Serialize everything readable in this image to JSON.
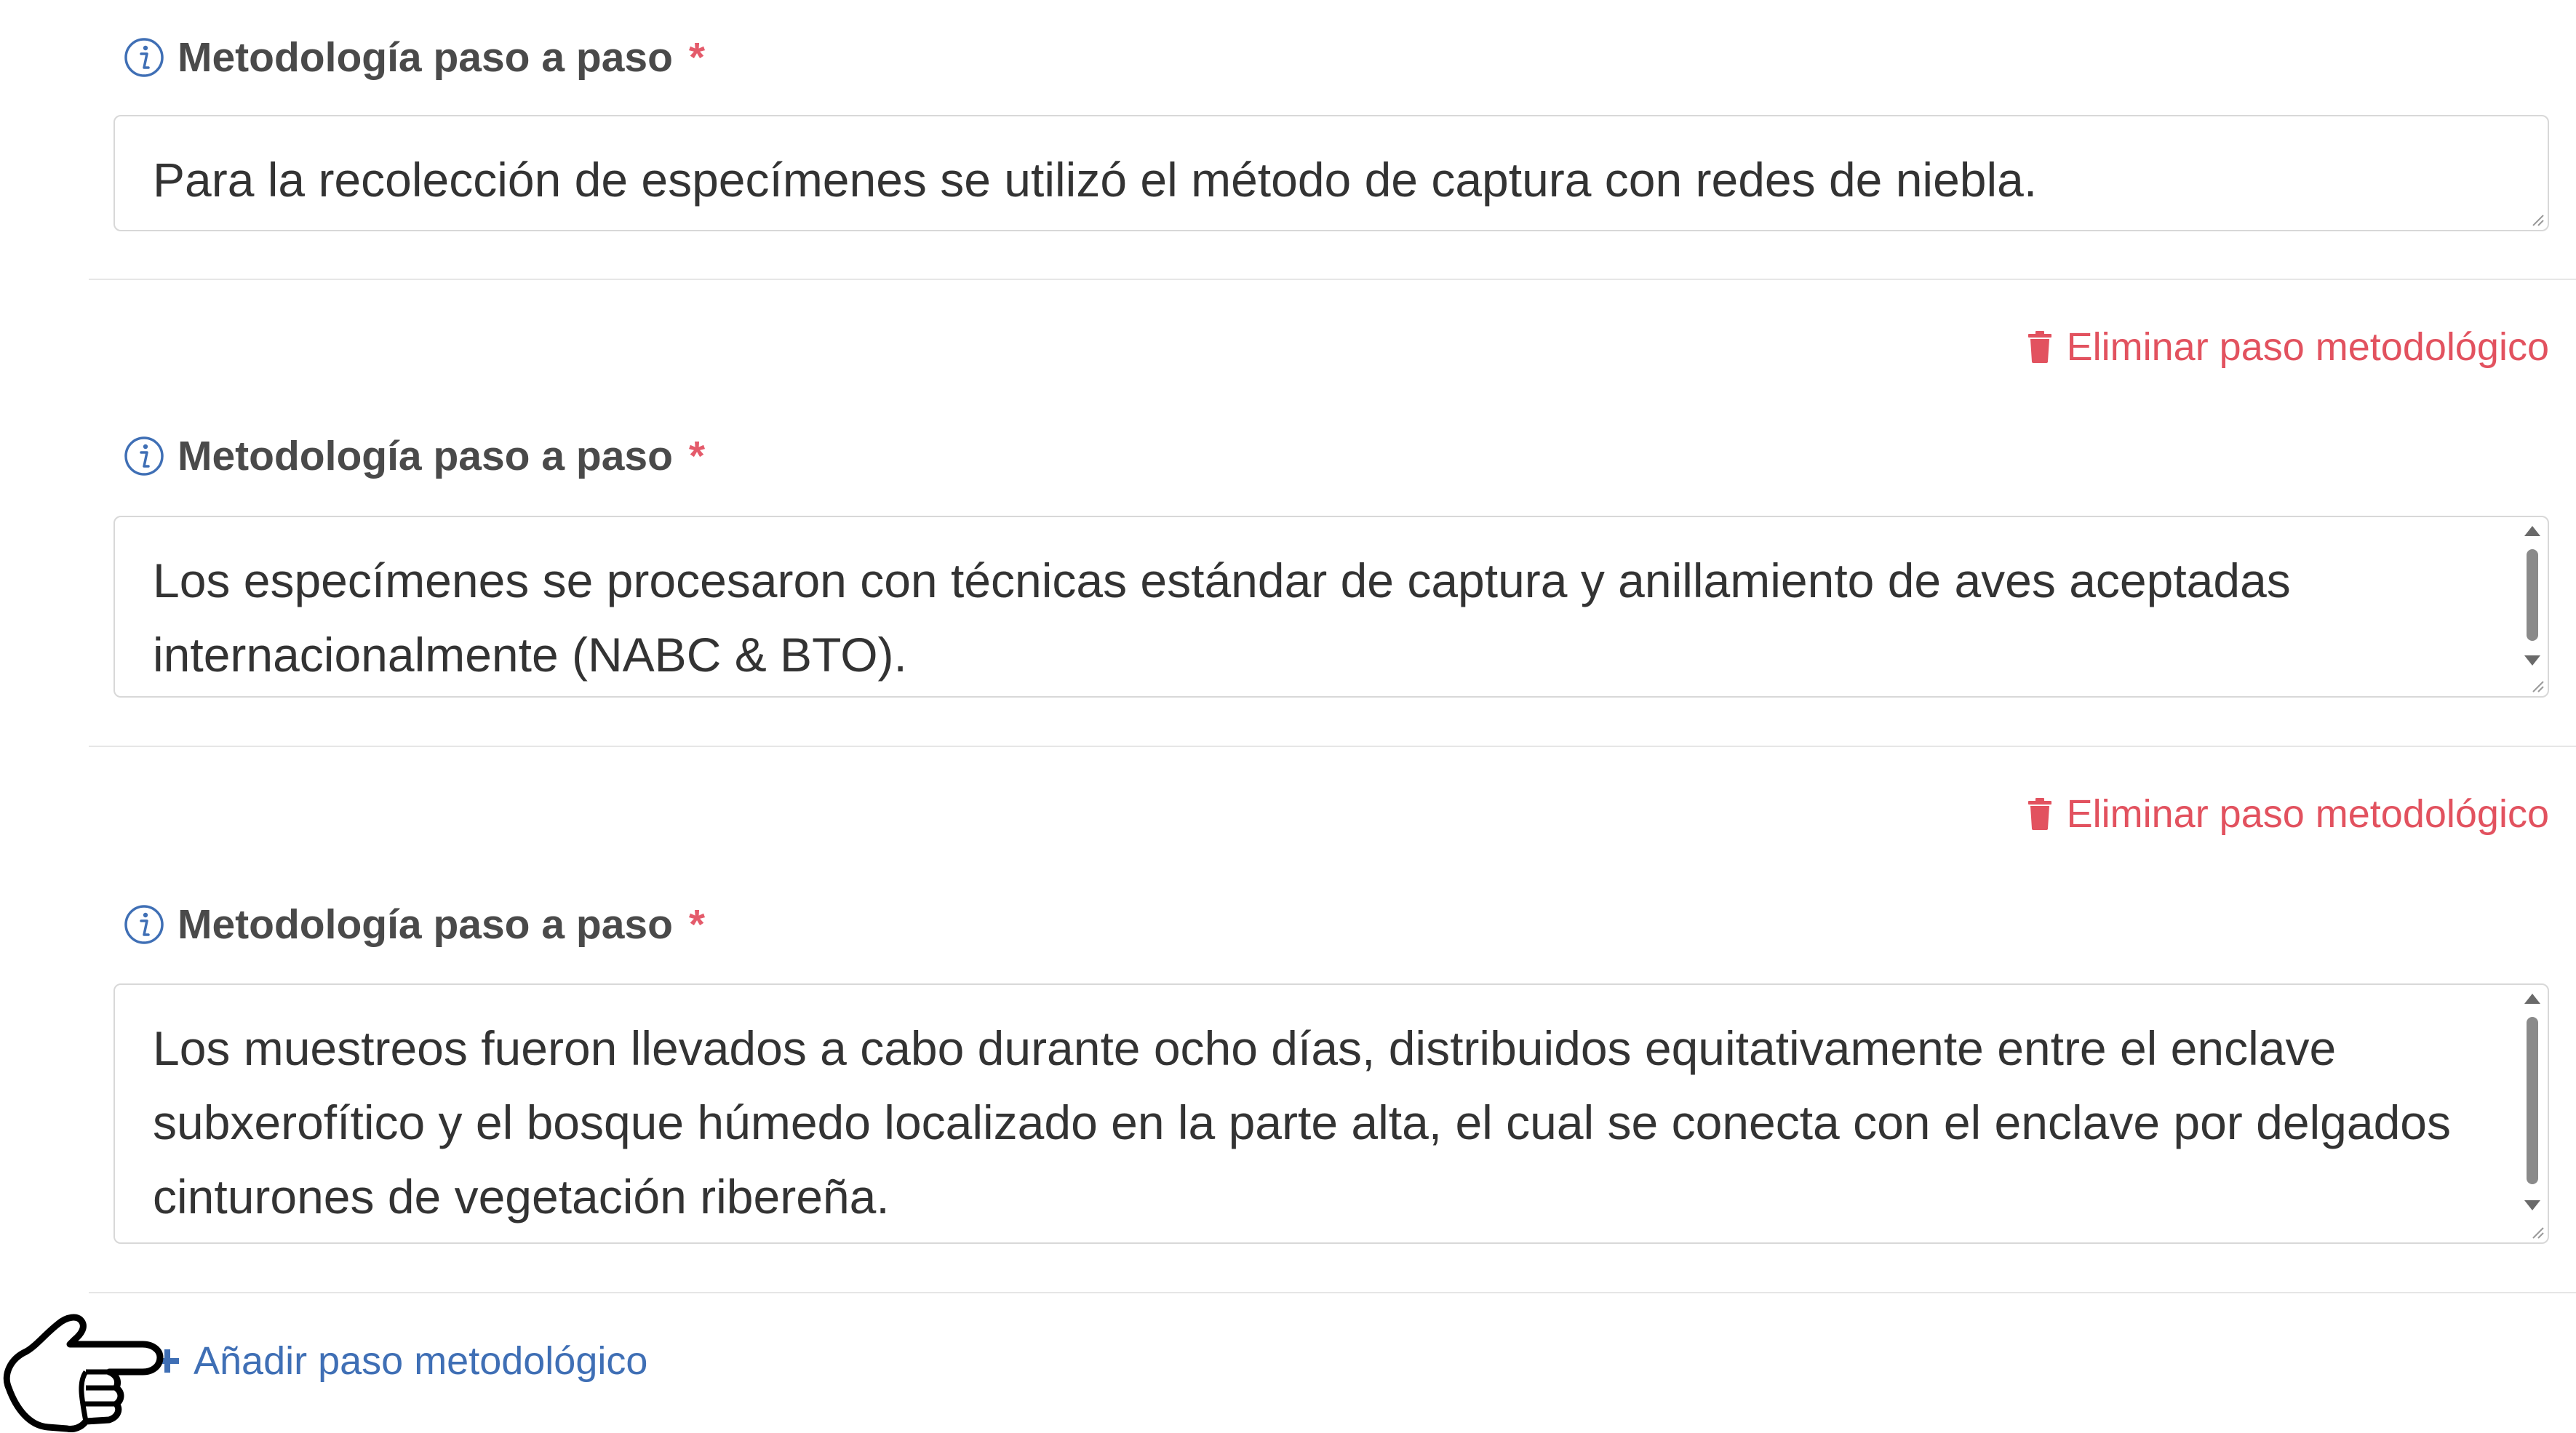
{
  "steps": [
    {
      "label": "Metodología paso a paso",
      "required_mark": "*",
      "value": "Para la recolección de especímenes se utilizó el método de captura con redes de niebla."
    },
    {
      "delete_label": "Eliminar paso metodológico",
      "label": "Metodología paso a paso",
      "required_mark": "*",
      "value": "Los especímenes se procesaron con técnicas estándar de captura y anillamiento de aves aceptadas internacionalmente (NABC & BTO)."
    },
    {
      "delete_label": "Eliminar paso metodológico",
      "label": "Metodología paso a paso",
      "required_mark": "*",
      "value": "Los muestreos fueron llevados a cabo durante ocho días, distribuidos equitativamente entre el enclave subxerofítico y el bosque húmedo localizado en la parte alta, el cual se conecta con el enclave por delgados cinturones de vegetación ribereña."
    }
  ],
  "add_step_label": "Añadir paso metodológico",
  "icons": {
    "info": "info-circle-icon",
    "delete": "trash-icon",
    "add": "plus-icon",
    "cursor": "pointing-hand-cursor-icon"
  },
  "colors": {
    "label": "#4a4a4a",
    "required": "#e45b6b",
    "delete": "#e2525f",
    "add": "#3f6fb5",
    "info": "#3f6fb5",
    "border": "#d8d8d8"
  }
}
